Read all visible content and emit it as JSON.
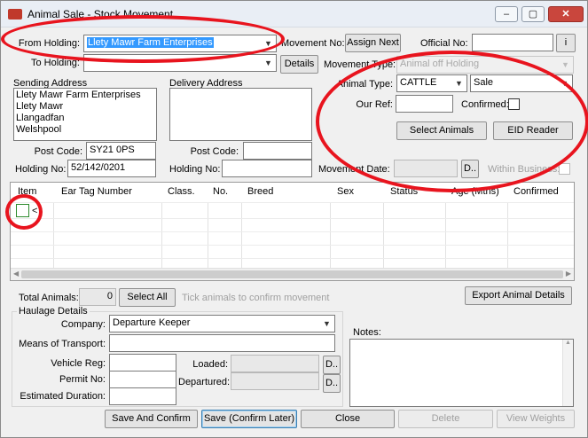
{
  "window": {
    "title": "Animal Sale - Stock Movement",
    "minimize": "–",
    "maximize": "▢",
    "close": "✕"
  },
  "from_holding": {
    "label": "From Holding:",
    "value": "Llety Mawr Farm Enterprises"
  },
  "to_holding": {
    "label": "To Holding:",
    "value": "",
    "details_button": "Details"
  },
  "movement_no": {
    "label": "Movement No:",
    "button": "Assign Next"
  },
  "official_no": {
    "label": "Official No:",
    "value": "",
    "info_button": "i"
  },
  "movement_type": {
    "label": "Movement Type:",
    "value": "Animal off Holding"
  },
  "sending_address": {
    "label": "Sending Address",
    "lines": [
      "Llety Mawr Farm Enterprises",
      "Llety Mawr",
      "Llangadfan",
      "Welshpool"
    ],
    "post_code_label": "Post Code:",
    "post_code": "SY21 0PS",
    "holding_no_label": "Holding No:",
    "holding_no": "52/142/0201"
  },
  "delivery_address": {
    "label": "Delivery Address",
    "post_code_label": "Post Code:",
    "post_code": "",
    "holding_no_label": "Holding No:",
    "holding_no": ""
  },
  "animal_type": {
    "label": "Animal Type:",
    "value": "CATTLE",
    "sale_value": "Sale"
  },
  "our_ref": {
    "label": "Our Ref:",
    "value": ""
  },
  "confirmed": {
    "label": "Confirmed:"
  },
  "buttons": {
    "select_animals": "Select Animals",
    "eid_reader": "EID Reader",
    "select_all": "Select All",
    "export_animal_details": "Export Animal Details",
    "save_and_confirm": "Save And Confirm",
    "save_confirm_later": "Save (Confirm Later)",
    "close": "Close",
    "delete": "Delete",
    "view_weights": "View Weights",
    "date_picker": "D.."
  },
  "movement_date": {
    "label": "Movement Date:",
    "value": ""
  },
  "within_business": {
    "label": "Within Business:"
  },
  "grid": {
    "columns": [
      "Item",
      "Ear Tag Number",
      "Class.",
      "No.",
      "Breed",
      "Sex",
      "Status",
      "Age (Mths)",
      "Confirmed"
    ],
    "row_marker": "<"
  },
  "totals": {
    "label": "Total Animals:",
    "value": "0",
    "hint": "Tick animals to confirm movement"
  },
  "haulage": {
    "label": "Haulage Details",
    "company_label": "Company:",
    "company_value": "Departure Keeper",
    "transport_label": "Means of Transport:",
    "vehicle_reg_label": "Vehicle Reg:",
    "permit_no_label": "Permit No:",
    "duration_label": "Estimated Duration:",
    "loaded_label": "Loaded:",
    "departured_label": "Departured:"
  },
  "notes": {
    "label": "Notes:",
    "value": ""
  },
  "colors": {
    "annotation_red": "#e8141e",
    "selection_blue": "#3399ff"
  }
}
